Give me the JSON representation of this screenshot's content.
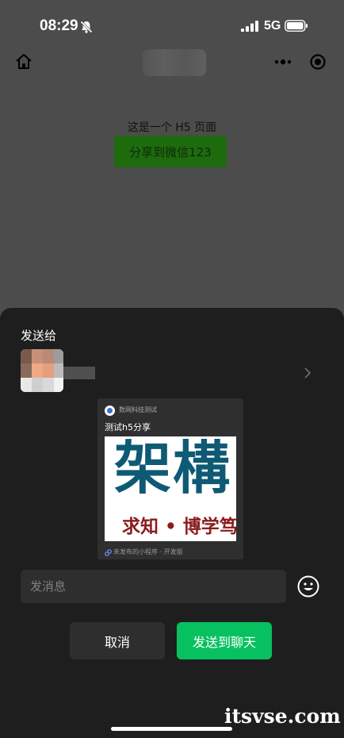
{
  "status_bar": {
    "time": "08:29",
    "network": "5G",
    "icons": [
      "bell-off-icon",
      "signal-icon",
      "battery-icon"
    ]
  },
  "nav": {
    "icons": [
      "home-icon",
      "more-icon",
      "capsule-close-icon"
    ]
  },
  "page": {
    "h5_text": "这是一个 H5 页面",
    "share_button": "分享到微信123"
  },
  "sheet": {
    "send_to_label": "发送给",
    "card": {
      "app_name": "数网科技测试",
      "title": "测试h5分享",
      "image_text_large": "架構",
      "image_text_small": "求知 • 博学笃",
      "footer": "未发布的小程序 · 开发版"
    },
    "message_placeholder": "发消息",
    "cancel_label": "取消",
    "send_label": "发送到聊天"
  },
  "watermark": "itsvse.com",
  "colors": {
    "accent": "#07c160",
    "sheet_bg": "#1e1e1e",
    "overlay_bg": "#4c4c4c"
  }
}
